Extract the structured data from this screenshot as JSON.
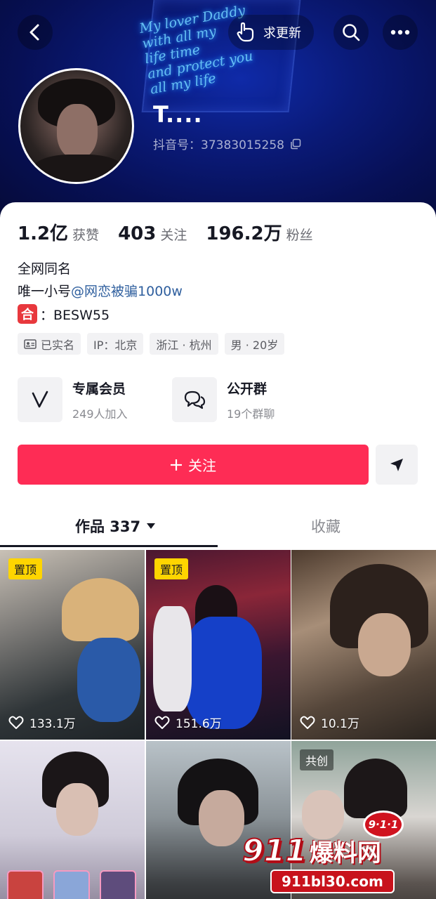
{
  "header": {
    "neon_lines": [
      "My lover Daddy",
      "with all my",
      "life time",
      "and protect you",
      "all my life"
    ],
    "request_update_label": "求更新",
    "nickname": "T....",
    "douyin_id": "抖音号：37383015258"
  },
  "stats": [
    {
      "value": "1.2亿",
      "label": "获赞"
    },
    {
      "value": "403",
      "label": "关注"
    },
    {
      "value": "196.2万",
      "label": "粉丝"
    }
  ],
  "bio": {
    "line1": "全网同名",
    "line2_prefix": "唯一小号",
    "line2_mention": "@网恋被骗1000w",
    "line3_badge": "合",
    "line3_text": "：BESW55"
  },
  "tags": [
    "已实名",
    "IP：北京",
    "浙江 · 杭州",
    "男 · 20岁"
  ],
  "features": [
    {
      "title": "专属会员",
      "subtitle": "249人加入"
    },
    {
      "title": "公开群",
      "subtitle": "19个群聊"
    }
  ],
  "actions": {
    "follow_label": "关注"
  },
  "tabs": {
    "works_label": "作品 337",
    "favorites_label": "收藏"
  },
  "videos": [
    {
      "badge": "置顶",
      "likes": "133.1万"
    },
    {
      "badge": "置顶",
      "likes": "151.6万"
    },
    {
      "badge": "",
      "likes": "10.1万"
    },
    {
      "badge": "",
      "likes": ""
    },
    {
      "badge": "",
      "likes": ""
    },
    {
      "badge": "共创",
      "likes": ""
    }
  ],
  "watermark": {
    "badge": "9·1·1",
    "brand_num": "911",
    "brand_cn": "爆料网",
    "url": "911bl30.com"
  },
  "colors": {
    "accent": "#fe2c55",
    "pin_badge": "#fed500",
    "mention": "#2f5f9e",
    "header_bg": "#0a1a78"
  }
}
